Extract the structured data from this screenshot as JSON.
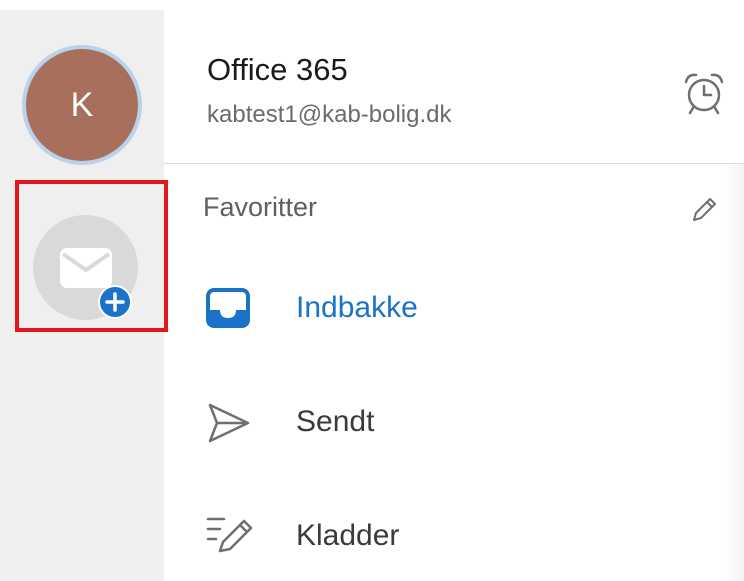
{
  "rail": {
    "avatar_initial": "K"
  },
  "header": {
    "title": "Office 365",
    "email": "kabtest1@kab-bolig.dk"
  },
  "favorites": {
    "label": "Favoritter"
  },
  "folders": [
    {
      "label": "Indbakke",
      "icon": "inbox-icon",
      "selected": true
    },
    {
      "label": "Sendt",
      "icon": "send-icon",
      "selected": false
    },
    {
      "label": "Kladder",
      "icon": "drafts-icon",
      "selected": false
    }
  ],
  "colors": {
    "accent": "#1a73c9",
    "avatar": "#a86f5c",
    "highlight": "#e4151b",
    "rail": "#efefef"
  }
}
